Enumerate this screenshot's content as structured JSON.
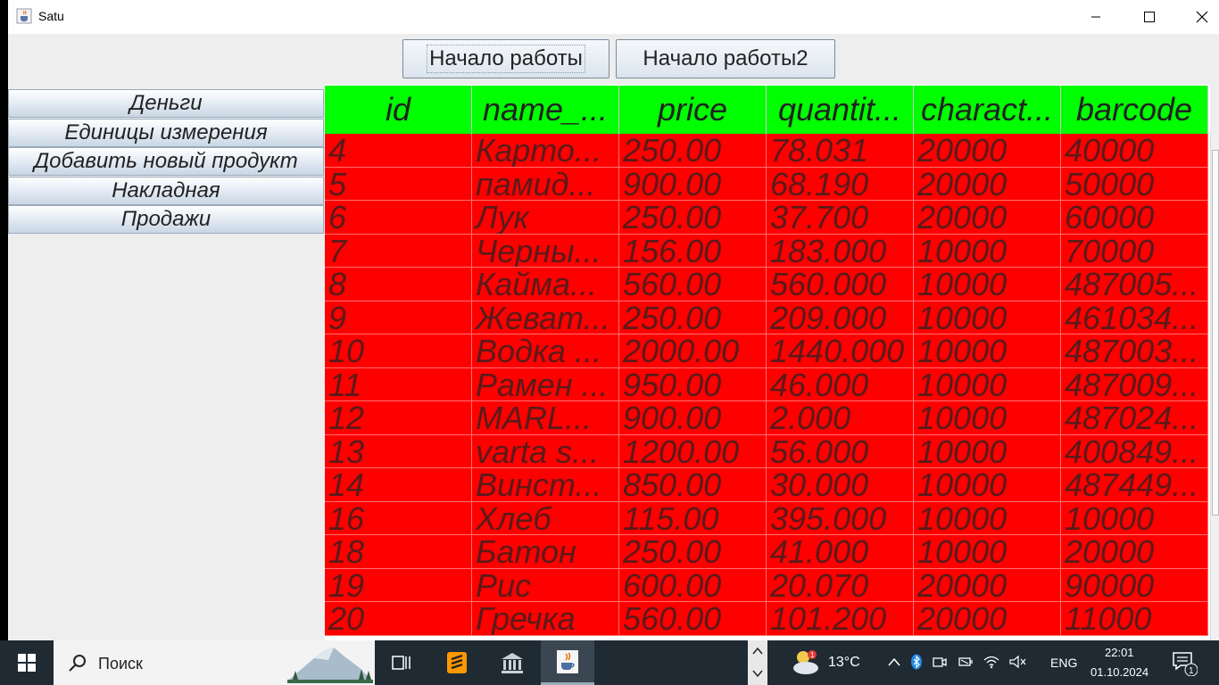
{
  "window": {
    "title": "Satu"
  },
  "toolbar": {
    "start_label": "Начало работы",
    "start2_label": "Начало работы2"
  },
  "sidebar": {
    "items": [
      {
        "label": "Деньги"
      },
      {
        "label": "Единицы измерения"
      },
      {
        "label": "Добавить новый продукт"
      },
      {
        "label": "Накладная"
      },
      {
        "label": "Продажи"
      }
    ]
  },
  "table": {
    "columns": [
      "id",
      "name_...",
      "price",
      "quantit...",
      "charact...",
      "barcode"
    ],
    "rows": [
      [
        "4",
        "Карто...",
        "250.00",
        "78.031",
        "20000",
        "40000"
      ],
      [
        "5",
        "памид...",
        "900.00",
        "68.190",
        "20000",
        "50000"
      ],
      [
        "6",
        "Лук",
        "250.00",
        "37.700",
        "20000",
        "60000"
      ],
      [
        "7",
        "Черны...",
        "156.00",
        "183.000",
        "10000",
        "70000"
      ],
      [
        "8",
        "Кайма...",
        "560.00",
        "560.000",
        "10000",
        "487005..."
      ],
      [
        "9",
        "Жеват...",
        "250.00",
        "209.000",
        "10000",
        "461034..."
      ],
      [
        "10",
        "Водка ...",
        "2000.00",
        "1440.000",
        "10000",
        "487003..."
      ],
      [
        "11",
        "Рамен ...",
        "950.00",
        "46.000",
        "10000",
        "487009..."
      ],
      [
        "12",
        "MARL...",
        "900.00",
        "2.000",
        "10000",
        "487024..."
      ],
      [
        "13",
        "varta s...",
        "1200.00",
        "56.000",
        "10000",
        "400849..."
      ],
      [
        "14",
        "Винст...",
        "850.00",
        "30.000",
        "10000",
        "487449..."
      ],
      [
        "16",
        "Хлеб",
        "115.00",
        "395.000",
        "10000",
        "10000"
      ],
      [
        "18",
        "Батон",
        "250.00",
        "41.000",
        "10000",
        "20000"
      ],
      [
        "19",
        "Рис",
        "600.00",
        "20.070",
        "20000",
        "90000"
      ],
      [
        "20",
        "Гречка",
        "560.00",
        "101.200",
        "20000",
        "11000"
      ]
    ]
  },
  "colors": {
    "header_bg": "#00ff00",
    "row_bg": "#ff0000",
    "taskbar_bg": "#1f2a33"
  },
  "taskbar": {
    "search_placeholder": "Поиск",
    "temperature": "13°C",
    "language": "ENG",
    "time": "22:01",
    "date": "01.10.2024",
    "weather_badge": "1",
    "notification_count": "1"
  }
}
